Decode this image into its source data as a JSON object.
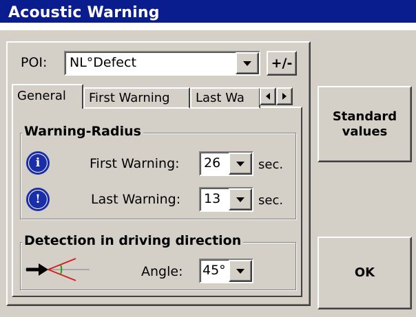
{
  "window": {
    "title": "Acoustic Warning"
  },
  "poi": {
    "label": "POI:",
    "value": "NL°Defect",
    "toggle_label": "+/-"
  },
  "tabs": [
    {
      "label": "General"
    },
    {
      "label": "First Warning"
    },
    {
      "label": "Last Wa"
    }
  ],
  "warning_radius": {
    "title": "Warning-Radius",
    "first": {
      "label": "First Warning:",
      "value": "26",
      "unit": "sec.",
      "icon": "info-icon"
    },
    "last": {
      "label": "Last Warning:",
      "value": "13",
      "unit": "sec.",
      "icon": "exclamation-icon"
    }
  },
  "detection": {
    "title": "Detection in driving direction",
    "angle_label": "Angle:",
    "angle_value": "45°",
    "icon": "direction-angle-icon"
  },
  "buttons": {
    "standard_values": "Standard values",
    "ok": "OK"
  },
  "colors": {
    "title_bar": "#0a1d8e",
    "face": "#d4d0c8",
    "icon_blue": "#1a2ea8"
  }
}
